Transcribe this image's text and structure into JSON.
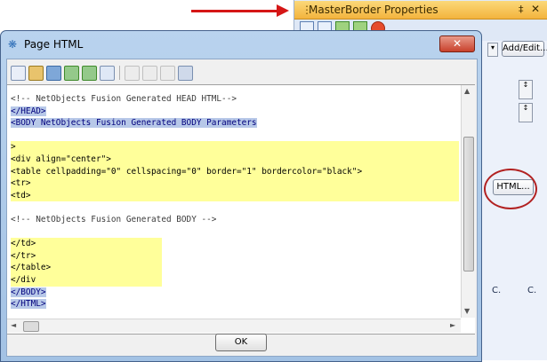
{
  "props_panel": {
    "title": "MasterBorder Properties",
    "pin_glyph": "‡",
    "close_glyph": "✕",
    "add_edit_label": "Add/Edit...",
    "html_button_label": "HTML...",
    "bottom_items": [
      "C.",
      "C."
    ],
    "spinner_glyph": "↕"
  },
  "dialog": {
    "title": "Page HTML",
    "close_glyph": "✕",
    "ok_label": "OK",
    "code_lines": [
      {
        "text": "<!-- NetObjects Fusion Generated HEAD HTML-->",
        "style": "comment"
      },
      {
        "text": "</HEAD>",
        "style": "sel"
      },
      {
        "text": "<BODY NetObjects Fusion Generated BODY Parameters",
        "style": "sel"
      },
      {
        "text": "",
        "style": "plain"
      },
      {
        "text": ">",
        "style": "hl"
      },
      {
        "text": "<div align=\"center\">",
        "style": "hl"
      },
      {
        "text": "<table cellpadding=\"0\" cellspacing=\"0\" border=\"1\" bordercolor=\"black\">",
        "style": "hl"
      },
      {
        "text": "<tr>",
        "style": "hl"
      },
      {
        "text": "<td>",
        "style": "hl"
      },
      {
        "text": "",
        "style": "plain"
      },
      {
        "text": "<!-- NetObjects Fusion Generated BODY -->",
        "style": "comment"
      },
      {
        "text": "",
        "style": "plain"
      },
      {
        "text": "</td>",
        "style": "hl"
      },
      {
        "text": "</tr>",
        "style": "hl"
      },
      {
        "text": "</table>",
        "style": "hl"
      },
      {
        "text": "</div",
        "style": "hl"
      },
      {
        "text": "</BODY>",
        "style": "sel"
      },
      {
        "text": "</HTML>",
        "style": "sel"
      }
    ]
  },
  "colors": {
    "annotation_red": "#d51616",
    "selection_blue": "#b7c8e8",
    "highlight_yellow": "#ffff9a"
  }
}
